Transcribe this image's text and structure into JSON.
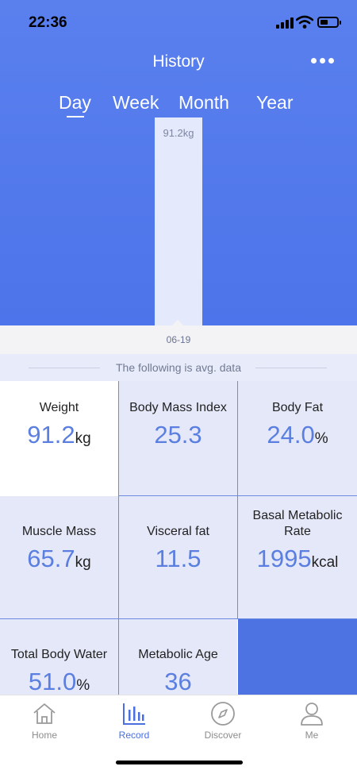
{
  "status": {
    "time": "22:36"
  },
  "header": {
    "title": "History"
  },
  "tabs": [
    {
      "label": "Day"
    },
    {
      "label": "Week"
    },
    {
      "label": "Month"
    },
    {
      "label": "Year"
    }
  ],
  "chart_data": {
    "type": "bar",
    "categories": [
      "06-19"
    ],
    "values": [
      91.2
    ],
    "data_labels": [
      "91.2kg"
    ]
  },
  "summary_note": "The following is avg. data",
  "metrics": [
    {
      "label": "Weight",
      "value": "91.2",
      "unit": "kg"
    },
    {
      "label": "Body Mass Index",
      "value": "25.3",
      "unit": ""
    },
    {
      "label": "Body Fat",
      "value": "24.0",
      "unit": "%"
    },
    {
      "label": "Muscle Mass",
      "value": "65.7",
      "unit": "kg"
    },
    {
      "label": "Visceral fat",
      "value": "11.5",
      "unit": ""
    },
    {
      "label": "Basal Metabolic Rate",
      "value": "1995",
      "unit": "kcal"
    },
    {
      "label": "Total Body Water",
      "value": "51.0",
      "unit": "%"
    },
    {
      "label": "Metabolic Age",
      "value": "36",
      "unit": ""
    }
  ],
  "nav": [
    {
      "label": "Home",
      "icon": "home-icon"
    },
    {
      "label": "Record",
      "icon": "bar-chart-icon"
    },
    {
      "label": "Discover",
      "icon": "compass-icon"
    },
    {
      "label": "Me",
      "icon": "person-icon"
    }
  ],
  "colors": {
    "header": "#5a80ee",
    "value": "#5b7fe0",
    "cell": "#e4e8f9",
    "accent": "#4d73e3",
    "nav_active": "#4a6fe0"
  }
}
